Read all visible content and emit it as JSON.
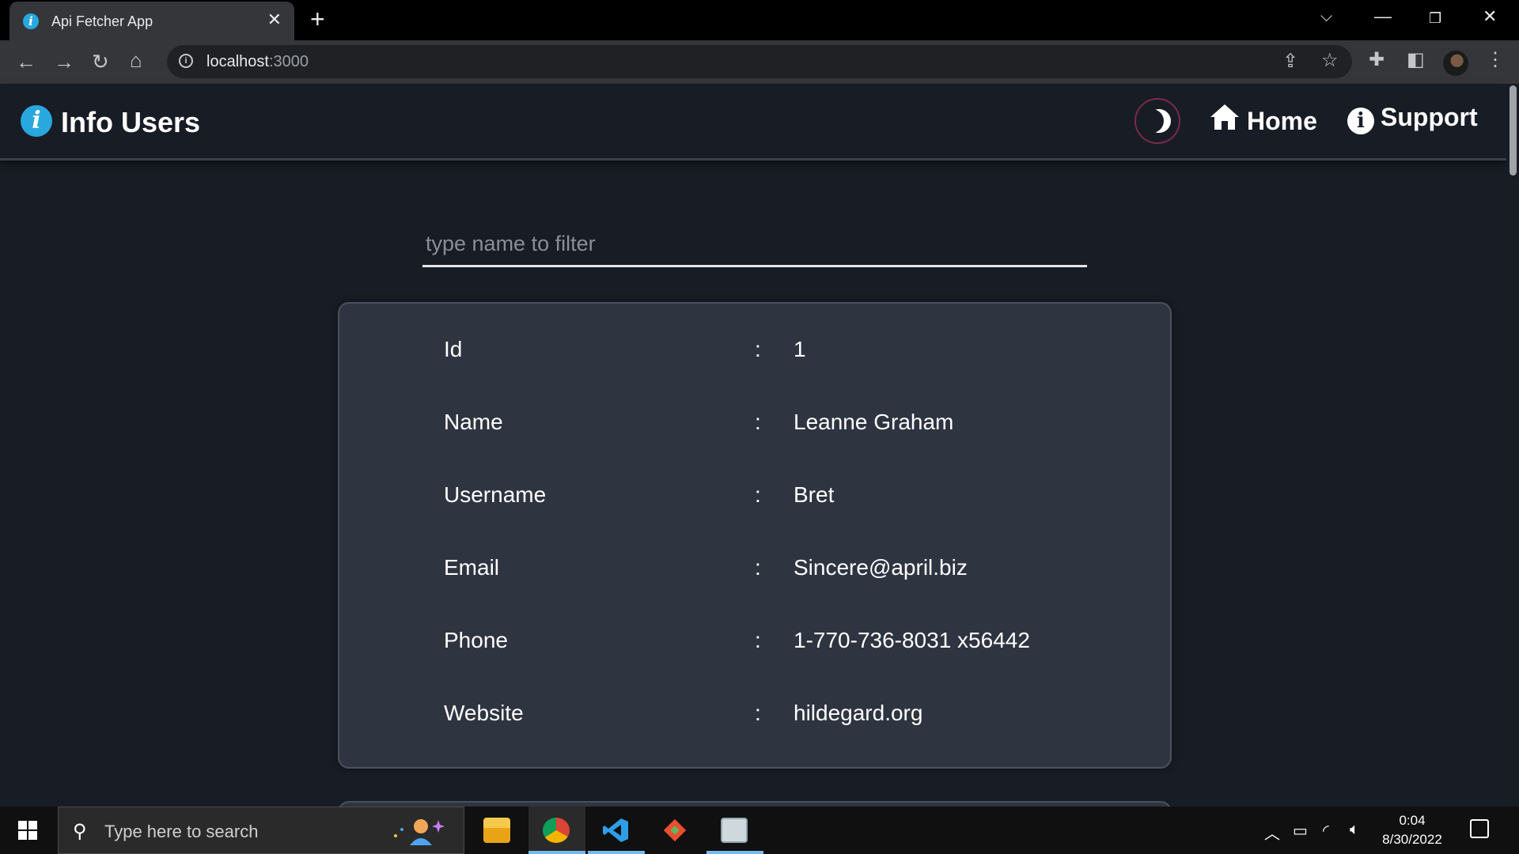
{
  "browser": {
    "tab_title": "Api Fetcher App",
    "url_host": "localhost",
    "url_port": ":3000"
  },
  "header": {
    "brand": "Info Users",
    "nav": {
      "home": "Home",
      "support": "Support"
    }
  },
  "filter": {
    "placeholder": "type name to filter",
    "value": ""
  },
  "user_card": {
    "separator": ":",
    "rows": [
      {
        "label": "Id",
        "value": "1"
      },
      {
        "label": "Name",
        "value": "Leanne Graham"
      },
      {
        "label": "Username",
        "value": "Bret"
      },
      {
        "label": "Email",
        "value": "Sincere@april.biz"
      },
      {
        "label": "Phone",
        "value": "1-770-736-8031 x56442"
      },
      {
        "label": "Website",
        "value": "hildegard.org"
      }
    ]
  },
  "taskbar": {
    "search_placeholder": "Type here to search",
    "time": "0:04",
    "date": "8/30/2022"
  }
}
